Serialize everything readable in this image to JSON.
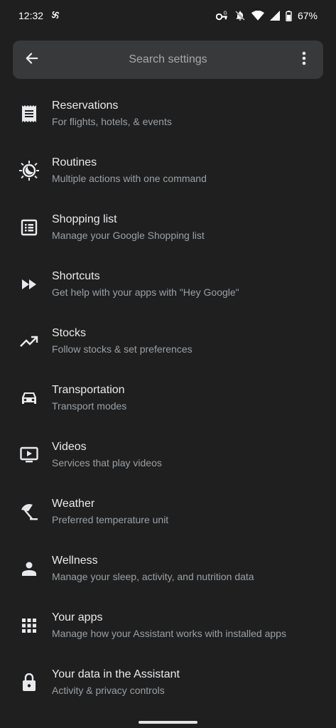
{
  "status_bar": {
    "time": "12:32",
    "battery": "67%",
    "icons": [
      "pinwheel-icon",
      "vpn-key-icon",
      "bell-off-icon",
      "wifi-icon",
      "signal-icon",
      "battery-icon"
    ]
  },
  "search": {
    "placeholder": "Search settings",
    "back_icon": "arrow-back-icon",
    "menu_icon": "more-vert-icon"
  },
  "items": [
    {
      "title": "Reservations",
      "subtitle": "For flights, hotels, & events",
      "icon": "receipt-icon"
    },
    {
      "title": "Routines",
      "subtitle": "Multiple actions with one command",
      "icon": "routine-sun-moon-icon"
    },
    {
      "title": "Shopping list",
      "subtitle": "Manage your Google Shopping list",
      "icon": "list-box-icon"
    },
    {
      "title": "Shortcuts",
      "subtitle": "Get help with your apps with \"Hey Google\"",
      "icon": "fast-forward-icon"
    },
    {
      "title": "Stocks",
      "subtitle": "Follow stocks & set preferences",
      "icon": "trending-up-icon"
    },
    {
      "title": "Transportation",
      "subtitle": "Transport modes",
      "icon": "car-icon"
    },
    {
      "title": "Videos",
      "subtitle": "Services that play videos",
      "icon": "tv-play-icon"
    },
    {
      "title": "Weather",
      "subtitle": "Preferred temperature unit",
      "icon": "beach-umbrella-icon"
    },
    {
      "title": "Wellness",
      "subtitle": "Manage your sleep, activity, and nutrition data",
      "icon": "person-icon"
    },
    {
      "title": "Your apps",
      "subtitle": "Manage how your Assistant works with installed apps",
      "icon": "apps-grid-icon"
    },
    {
      "title": "Your data in the Assistant",
      "subtitle": "Activity & privacy controls",
      "icon": "lock-icon"
    }
  ]
}
